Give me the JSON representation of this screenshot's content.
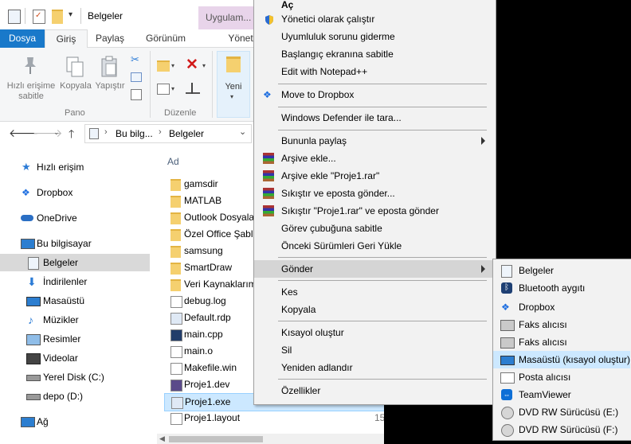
{
  "window": {
    "title": "Belgeler",
    "context_tab": "Uygulam..."
  },
  "ribbon": {
    "tabs": [
      "Dosya",
      "Giriş",
      "Paylaş",
      "Görünüm",
      "Yönet"
    ],
    "quick_access_label": "Hızlı erişime sabitle",
    "quick_access_line1": "Hızlı erişime",
    "quick_access_line2": "sabitle",
    "copy_label": "Kopyala",
    "paste_label": "Yapıştır",
    "group_pano": "Pano",
    "group_duzenle": "Düzenle",
    "new_label": "Yeni"
  },
  "address": {
    "crumb1": "Bu bilg...",
    "crumb2": "Belgeler"
  },
  "nav": [
    {
      "label": "Hızlı erişim",
      "icon": "star-icon"
    },
    {
      "label": "Dropbox",
      "icon": "dropbox-icon"
    },
    {
      "label": "OneDrive",
      "icon": "onedrive-icon"
    },
    {
      "label": "Bu bilgisayar",
      "icon": "computer-icon"
    },
    {
      "label": "Belgeler",
      "icon": "documents-icon"
    },
    {
      "label": "İndirilenler",
      "icon": "download-icon"
    },
    {
      "label": "Masaüstü",
      "icon": "desktop-icon"
    },
    {
      "label": "Müzikler",
      "icon": "music-icon"
    },
    {
      "label": "Resimler",
      "icon": "pictures-icon"
    },
    {
      "label": "Videolar",
      "icon": "videos-icon"
    },
    {
      "label": "Yerel Disk (C:)",
      "icon": "drive-icon"
    },
    {
      "label": "depo (D:)",
      "icon": "drive-icon"
    },
    {
      "label": "Ağ",
      "icon": "network-icon"
    }
  ],
  "files": {
    "header": "Ad",
    "items": [
      {
        "name": "gamsdir",
        "type": "folder"
      },
      {
        "name": "MATLAB",
        "type": "folder"
      },
      {
        "name": "Outlook Dosyaları",
        "type": "folder"
      },
      {
        "name": "Özel Office Şablonları",
        "type": "folder"
      },
      {
        "name": "samsung",
        "type": "folder"
      },
      {
        "name": "SmartDraw",
        "type": "folder"
      },
      {
        "name": "Veri Kaynaklarım",
        "type": "folder"
      },
      {
        "name": "debug.log",
        "type": "file"
      },
      {
        "name": "Default.rdp",
        "type": "file"
      },
      {
        "name": "main.cpp",
        "type": "file"
      },
      {
        "name": "main.o",
        "type": "file"
      },
      {
        "name": "Makefile.win",
        "type": "file"
      },
      {
        "name": "Proje1.dev",
        "type": "file"
      },
      {
        "name": "Proje1.exe",
        "type": "exe"
      },
      {
        "name": "Proje1.layout",
        "type": "file"
      }
    ],
    "col_fragment_1": "1",
    "col_fragment_2": "15"
  },
  "context_menu": {
    "items": [
      {
        "label": "Aç"
      },
      {
        "label": "Yönetici olarak çalıştır",
        "icon": "shield-icon"
      },
      {
        "label": "Uyumluluk sorunu giderme"
      },
      {
        "label": "Başlangıç ekranına sabitle"
      },
      {
        "label": "Edit with Notepad++",
        "icon": "notepadpp-icon"
      },
      {
        "label": "Move to Dropbox",
        "icon": "dropbox-icon"
      },
      {
        "label": "Windows Defender ile tara...",
        "icon": "defender-icon"
      },
      {
        "label": "Bununla paylaş"
      },
      {
        "label": "Arşive ekle...",
        "icon": "winrar-icon"
      },
      {
        "label": "Arşive ekle \"Proje1.rar\"",
        "icon": "winrar-icon"
      },
      {
        "label": "Sıkıştır ve eposta gönder...",
        "icon": "winrar-icon"
      },
      {
        "label": "Sıkıştır \"Proje1.rar\" ve eposta gönder",
        "icon": "winrar-icon"
      },
      {
        "label": "Görev çubuğuna sabitle"
      },
      {
        "label": "Önceki Sürümleri Geri Yükle"
      },
      {
        "label": "Gönder"
      },
      {
        "label": "Kes"
      },
      {
        "label": "Kopyala"
      },
      {
        "label": "Kısayol oluştur"
      },
      {
        "label": "Sil"
      },
      {
        "label": "Yeniden adlandır"
      },
      {
        "label": "Özellikler"
      }
    ]
  },
  "send_to_menu": {
    "items": [
      {
        "label": "Belgeler",
        "icon": "documents-icon"
      },
      {
        "label": "Bluetooth aygıtı",
        "icon": "bluetooth-icon"
      },
      {
        "label": "Dropbox",
        "icon": "dropbox-icon"
      },
      {
        "label": "Faks alıcısı",
        "icon": "fax-icon"
      },
      {
        "label": "Faks alıcısı",
        "icon": "fax-icon"
      },
      {
        "label": "Masaüstü (kısayol oluştur)",
        "icon": "desktop-icon"
      },
      {
        "label": "Posta alıcısı",
        "icon": "mail-icon"
      },
      {
        "label": "TeamViewer",
        "icon": "teamviewer-icon"
      },
      {
        "label": "DVD RW Sürücüsü (E:)",
        "icon": "dvd-drive-icon"
      },
      {
        "label": "DVD RW Sürücüsü (F:)",
        "icon": "dvd-drive-icon"
      }
    ]
  }
}
